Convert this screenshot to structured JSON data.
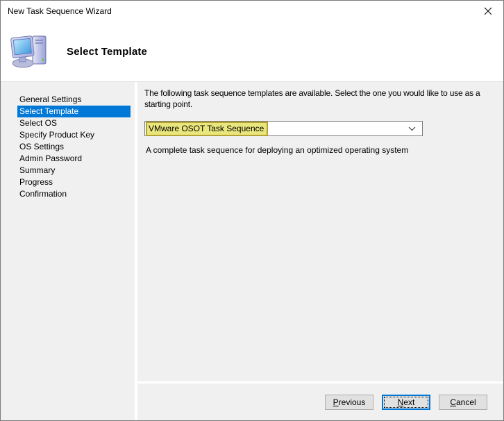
{
  "window": {
    "title": "New Task Sequence Wizard"
  },
  "header": {
    "title": "Select Template"
  },
  "sidebar": {
    "items": [
      {
        "label": "General Settings",
        "selected": false
      },
      {
        "label": "Select Template",
        "selected": true
      },
      {
        "label": "Select OS",
        "selected": false
      },
      {
        "label": "Specify Product Key",
        "selected": false
      },
      {
        "label": "OS Settings",
        "selected": false
      },
      {
        "label": "Admin Password",
        "selected": false
      },
      {
        "label": "Summary",
        "selected": false
      },
      {
        "label": "Progress",
        "selected": false
      },
      {
        "label": "Confirmation",
        "selected": false
      }
    ]
  },
  "content": {
    "instruction": "The following task sequence templates are available.  Select the one you would like to use as a starting point.",
    "template_dropdown": {
      "value": "VMware OSOT Task Sequence",
      "highlight_bg": "#e9e67c",
      "highlight_border": "#b3a233"
    },
    "description": "A complete task sequence for deploying an optimized operating system"
  },
  "footer": {
    "buttons": [
      {
        "label": "Previous",
        "mnemonic": "P",
        "focused": false
      },
      {
        "label": "Next",
        "mnemonic": "N",
        "focused": true
      },
      {
        "label": "Cancel",
        "mnemonic": "C",
        "focused": false
      }
    ]
  },
  "colors": {
    "selection_blue": "#0078d7",
    "body_gray": "#f0f0f0",
    "header_white": "#ffffff",
    "highlight_yellow": "#e9e67c",
    "highlight_border": "#b3a233",
    "button_gray": "#e1e1e1"
  }
}
